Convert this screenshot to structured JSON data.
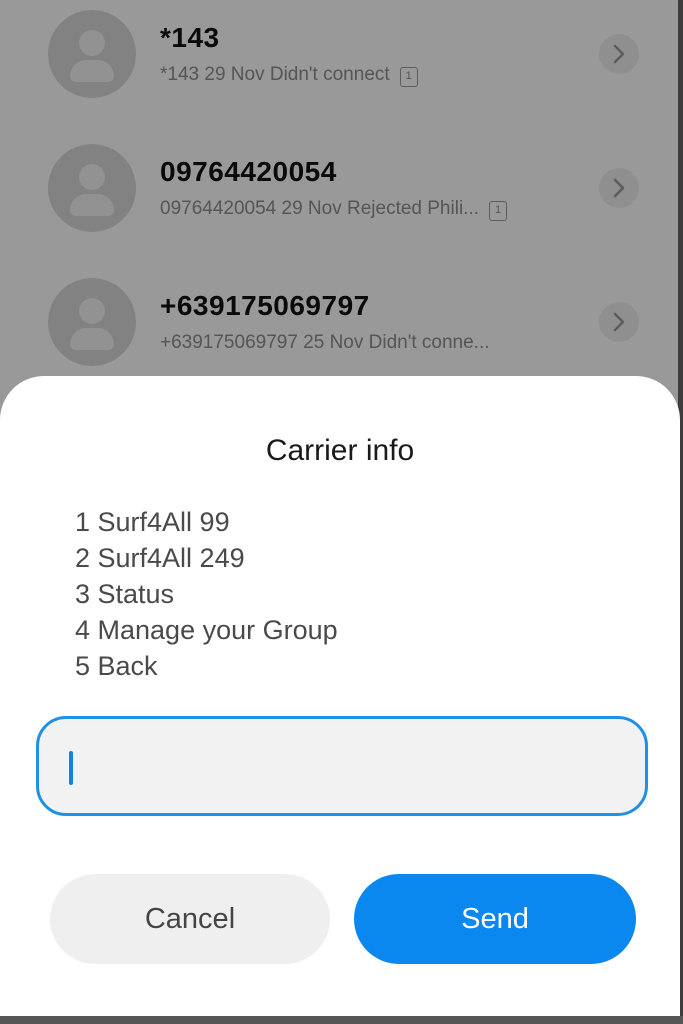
{
  "call_log": [
    {
      "name": "*143",
      "detail": "*143  29 Nov Didn't connect",
      "sim": "1"
    },
    {
      "name": "09764420054",
      "detail": "09764420054  29 Nov Rejected  Phili...",
      "sim": "1"
    },
    {
      "name": "+639175069797",
      "detail": "+639175069797  25 Nov Didn't conne..."
    }
  ],
  "dialog": {
    "title": "Carrier info",
    "menu": [
      "1 Surf4All 99",
      "2 Surf4All 249",
      "3 Status",
      "4 Manage your Group",
      "5 Back"
    ],
    "input_value": "",
    "cancel_label": "Cancel",
    "send_label": "Send"
  },
  "colors": {
    "accent": "#0a88f0",
    "input_border": "#1e90e6",
    "scrim": "rgba(0,0,0,0.40)"
  },
  "icons": [
    "contact-avatar-icon",
    "chevron-right-icon",
    "sim-card-icon"
  ]
}
